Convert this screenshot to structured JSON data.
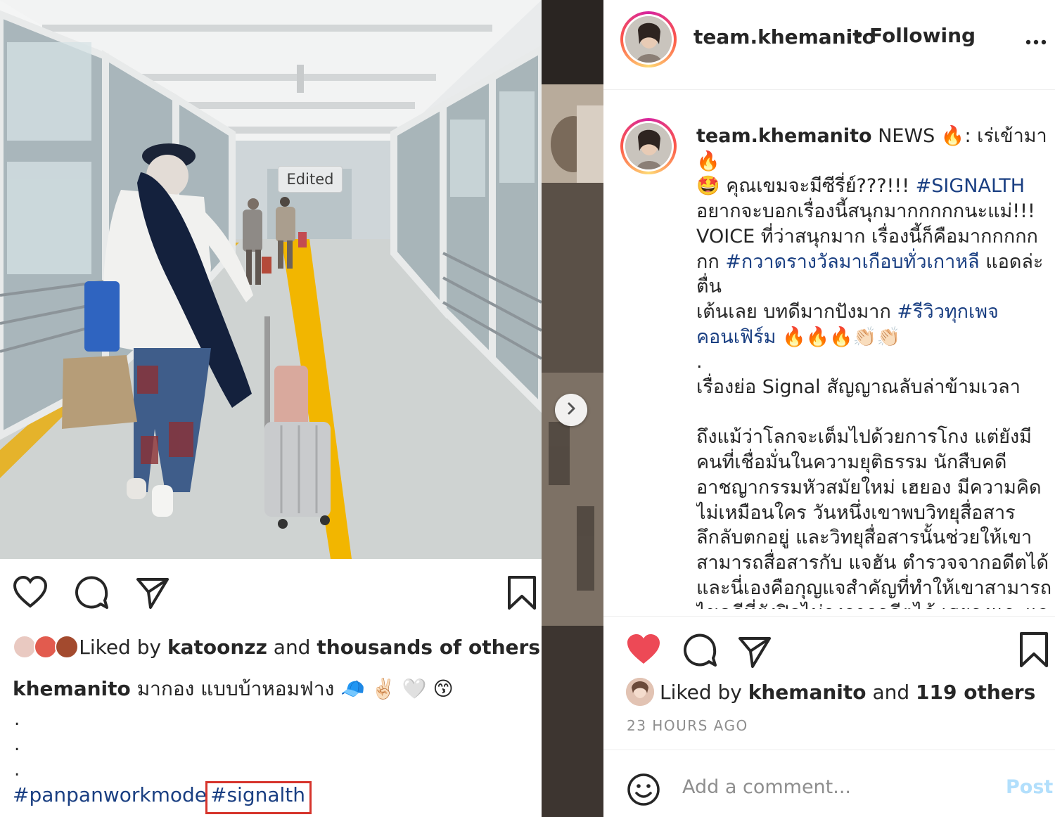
{
  "left_post": {
    "edited_badge": "Edited",
    "liked_by_prefix": "Liked by",
    "liked_by_user": "katoonzz",
    "liked_by_and": "and",
    "liked_by_rest": "thousands of others",
    "caption_user": "khemanito",
    "caption_text": "มากอง แบบบ้าหอมฟาง",
    "caption_emojis": "🧢 ✌🏻 🤍 😙",
    "dots": [
      ".",
      ".",
      "."
    ],
    "hashtag_1": "#panpanworkmode",
    "hashtag_2": "#signalth",
    "highlight_color": "#d6342c"
  },
  "right_post": {
    "header": {
      "username": "team.khemanito",
      "separator": "•",
      "follow_status": "Following"
    },
    "caption": {
      "username": "team.khemanito",
      "line1": "NEWS 🔥: เร่เข้ามา 🔥",
      "line2_prefix": "🤩 คุณเขมจะมีซีรี่ย์???!!!",
      "tag_signalth": "#SIGNALTH",
      "line3": "อยากจะบอกเรื่องนี้สนุกมากกกกกนะแม่!!!",
      "line4": "VOICE ที่ว่าสนุกมาก เรื่องนี้ก็คือมากกกกก",
      "line5_prefix": "กก",
      "tag_award": "#กวาดรางวัลมาเกือบทั่วเกาหลี",
      "line5_suffix": "แอดล่ะตื่น",
      "line6_prefix": "เต้นเลย บทดีมากปังมาก",
      "tag_review": "#รีวิวทุกเพจ",
      "tag_confirm": "คอนเฟิร์ม",
      "line7_emojis": "🔥🔥🔥👏🏻👏🏻",
      "dot": ".",
      "synopsis_title": "เรื่องย่อ Signal สัญญาณลับล่าข้ามเวลา",
      "synopsis_body": "ถึงแม้ว่าโลกจะเต็มไปด้วยการโกง แต่ยังมีคนที่เชื่อมั่นในความยุติธรรม นักสืบคดีอาชญากรรมหัวสมัยใหม่ เฮยอง มีความคิดไม่เหมือนใคร วันหนึ่งเขาพบวิทยุสื่อสารลึกลับตกอยู่ และวิทยุสื่อสารนั้นช่วยให้เขาสามารถสื่อสารกับ แจฮัน ตำรวจจากอดีตได้ และนี่เองคือกุญแจสำคัญที่ทำให้เขาสามารถไขคดีที่ยังปิดไม่ลงจากอดีตได้ เฮยองและแจฮันร่วมกันไขคดีต่างๆ ผ่านวิทยุสื่อสารได้อย่างราบลื่น โดยมีความร่วมมือจาก ซูฮยอน ที่พวกเขาเชื่อ"
    },
    "liked_by_prefix": "Liked by",
    "liked_by_user": "khemanito",
    "liked_by_and": "and",
    "liked_by_rest": "119 others",
    "timestamp": "23 HOURS AGO",
    "comment_placeholder": "Add a comment...",
    "post_label": "Post",
    "like_color": "#ed4956",
    "link_color": "#1a3f82",
    "post_button_color": "#b2dffc"
  },
  "icons": {
    "left": [
      "heart-icon",
      "comment-icon",
      "share-icon",
      "bookmark-icon"
    ],
    "right": [
      "heart-filled-icon",
      "comment-icon",
      "share-icon",
      "bookmark-icon",
      "smiley-icon",
      "more-dots-icon",
      "chevron-right-icon"
    ]
  }
}
